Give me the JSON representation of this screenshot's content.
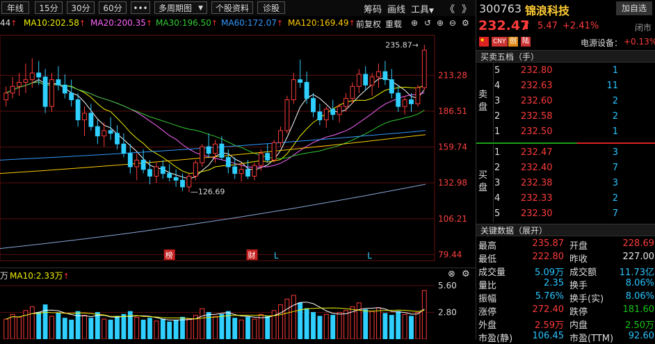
{
  "toolbar": {
    "periods": [
      "年线",
      "15分",
      "30分",
      "60分"
    ],
    "more": "•••",
    "multi_period": "多周期图",
    "stock_info": "个股资料",
    "diagnose": "诊股",
    "chips": "筹码",
    "draw": "画线",
    "tools": "工具",
    "collapse": "《",
    "expand": "》"
  },
  "ma_row": {
    "lead": "44",
    "ma10": "MA10:202.58",
    "ma20": "MA20:200.35",
    "ma30": "MA30:196.50",
    "ma60": "MA60:172.07",
    "ma120": "MA120:169.49",
    "adjust": "前复权",
    "overlay": "重载",
    "colors": {
      "ma10": "#f0f000",
      "ma20": "#ff66ff",
      "ma30": "#33cc33",
      "ma60": "#3399ff",
      "ma120": "#ffcc00"
    }
  },
  "chart_data": {
    "type": "candlestick",
    "y_axis_labels": [
      "213.28",
      "186.51",
      "159.74",
      "132.98",
      "106.21",
      "79.44"
    ],
    "y_axis_values": [
      213.28,
      186.51,
      159.74,
      132.98,
      106.21,
      79.44
    ],
    "high_annotation": "235.87",
    "low_annotation": "126.69",
    "event_markers": [
      {
        "label": "榜",
        "x": 0.39
      },
      {
        "label": "财",
        "x": 0.58
      },
      {
        "label": "L",
        "x": 0.635
      },
      {
        "label": "L",
        "x": 0.85
      }
    ],
    "candles": [
      [
        195,
        205,
        190,
        200
      ],
      [
        200,
        212,
        196,
        205
      ],
      [
        205,
        215,
        198,
        208
      ],
      [
        208,
        222,
        200,
        210
      ],
      [
        210,
        226,
        204,
        215
      ],
      [
        215,
        224,
        206,
        212
      ],
      [
        212,
        218,
        185,
        190
      ],
      [
        190,
        215,
        186,
        210
      ],
      [
        210,
        220,
        202,
        206
      ],
      [
        206,
        214,
        196,
        200
      ],
      [
        200,
        210,
        190,
        195
      ],
      [
        195,
        200,
        175,
        180
      ],
      [
        180,
        190,
        168,
        185
      ],
      [
        185,
        192,
        172,
        175
      ],
      [
        175,
        180,
        162,
        168
      ],
      [
        168,
        178,
        160,
        172
      ],
      [
        172,
        182,
        165,
        170
      ],
      [
        170,
        176,
        158,
        162
      ],
      [
        162,
        170,
        152,
        155
      ],
      [
        155,
        162,
        140,
        145
      ],
      [
        145,
        155,
        135,
        150
      ],
      [
        150,
        158,
        140,
        143
      ],
      [
        143,
        150,
        132,
        138
      ],
      [
        138,
        148,
        133,
        145
      ],
      [
        145,
        150,
        136,
        140
      ],
      [
        140,
        147,
        134,
        137
      ],
      [
        137,
        143,
        130,
        135
      ],
      [
        135,
        140,
        127,
        130
      ],
      [
        130,
        140,
        126,
        138
      ],
      [
        138,
        150,
        135,
        148
      ],
      [
        148,
        162,
        145,
        160
      ],
      [
        160,
        170,
        152,
        155
      ],
      [
        155,
        165,
        148,
        162
      ],
      [
        162,
        168,
        150,
        152
      ],
      [
        152,
        158,
        140,
        145
      ],
      [
        145,
        152,
        136,
        140
      ],
      [
        140,
        148,
        134,
        143
      ],
      [
        143,
        150,
        136,
        138
      ],
      [
        138,
        148,
        135,
        146
      ],
      [
        146,
        158,
        142,
        155
      ],
      [
        155,
        162,
        148,
        150
      ],
      [
        150,
        165,
        148,
        163
      ],
      [
        163,
        175,
        160,
        172
      ],
      [
        172,
        198,
        170,
        195
      ],
      [
        195,
        215,
        192,
        210
      ],
      [
        210,
        225,
        204,
        208
      ],
      [
        208,
        216,
        192,
        196
      ],
      [
        196,
        200,
        182,
        186
      ],
      [
        186,
        192,
        176,
        180
      ],
      [
        180,
        190,
        174,
        188
      ],
      [
        188,
        195,
        180,
        184
      ],
      [
        184,
        192,
        178,
        190
      ],
      [
        190,
        200,
        186,
        196
      ],
      [
        196,
        208,
        192,
        205
      ],
      [
        205,
        218,
        200,
        214
      ],
      [
        214,
        220,
        202,
        206
      ],
      [
        206,
        215,
        198,
        212
      ],
      [
        212,
        222,
        204,
        216
      ],
      [
        216,
        224,
        206,
        210
      ],
      [
        210,
        218,
        196,
        200
      ],
      [
        200,
        206,
        186,
        190
      ],
      [
        190,
        198,
        184,
        195
      ],
      [
        195,
        200,
        186,
        192
      ],
      [
        192,
        206,
        190,
        204
      ],
      [
        204,
        236,
        202,
        232
      ]
    ]
  },
  "volume": {
    "ma_label": "MA10:2.33万",
    "lead": "万",
    "y_axis_labels": [
      "5.60",
      "2.80"
    ],
    "values": [
      2.1,
      2.6,
      2.3,
      3.0,
      3.4,
      2.8,
      3.6,
      2.4,
      2.7,
      2.2,
      2.0,
      2.9,
      2.5,
      2.2,
      2.8,
      2.1,
      2.0,
      2.4,
      2.6,
      2.9,
      2.3,
      2.0,
      2.2,
      1.9,
      2.1,
      1.8,
      2.0,
      2.3,
      2.1,
      2.5,
      3.2,
      2.8,
      2.4,
      2.6,
      2.9,
      2.2,
      2.0,
      2.3,
      2.1,
      2.6,
      2.4,
      3.0,
      3.6,
      4.2,
      4.6,
      3.8,
      3.2,
      2.8,
      2.4,
      2.6,
      2.5,
      2.8,
      3.0,
      3.4,
      3.8,
      3.1,
      2.9,
      3.3,
      2.7,
      2.5,
      2.9,
      2.6,
      2.4,
      2.8,
      5.1
    ]
  },
  "quote": {
    "code": "300763",
    "name": "锦浪科技",
    "add_watch": "加自选",
    "price": "232.47",
    "change": "5.47",
    "pct": "+2.41%",
    "status": "闭市",
    "tags": [
      "CNY",
      "创",
      "陆"
    ],
    "sector": "电源设备：",
    "sector_pct": "+0.13%"
  },
  "orderbook": {
    "title": "买卖五档（手）",
    "sell_label": "卖盘",
    "buy_label": "买盘",
    "sell": [
      {
        "lvl": "5",
        "price": "232.80",
        "vol": "1"
      },
      {
        "lvl": "4",
        "price": "232.63",
        "vol": "11"
      },
      {
        "lvl": "3",
        "price": "232.60",
        "vol": "2"
      },
      {
        "lvl": "2",
        "price": "232.58",
        "vol": "2"
      },
      {
        "lvl": "1",
        "price": "232.50",
        "vol": "1"
      }
    ],
    "buy": [
      {
        "lvl": "1",
        "price": "232.47",
        "vol": "3"
      },
      {
        "lvl": "2",
        "price": "232.40",
        "vol": "7"
      },
      {
        "lvl": "3",
        "price": "232.38",
        "vol": "3"
      },
      {
        "lvl": "4",
        "price": "232.33",
        "vol": "2"
      },
      {
        "lvl": "5",
        "price": "232.30",
        "vol": "7"
      }
    ]
  },
  "keydata": {
    "title": "关键数据（展开）",
    "rows": [
      {
        "l1": "最高",
        "v1": "235.87",
        "c1": "red",
        "l2": "开盘",
        "v2": "228.69",
        "c2": "red"
      },
      {
        "l1": "最低",
        "v1": "222.80",
        "c1": "red",
        "l2": "昨收",
        "v2": "227.00",
        "c2": "white"
      },
      {
        "l1": "成交量",
        "v1": "5.09万",
        "c1": "cyan",
        "l2": "成交额",
        "v2": "11.73亿",
        "c2": "cyan"
      },
      {
        "l1": "量比",
        "v1": "2.35",
        "c1": "cyan",
        "l2": "换手",
        "v2": "8.06%",
        "c2": "cyan"
      },
      {
        "l1": "振幅",
        "v1": "5.76%",
        "c1": "cyan",
        "l2": "换手(实)",
        "v2": "8.06%",
        "c2": "cyan"
      },
      {
        "l1": "涨停",
        "v1": "272.40",
        "c1": "red",
        "l2": "跌停",
        "v2": "181.60",
        "c2": "green"
      },
      {
        "l1": "外盘",
        "v1": "2.59万",
        "c1": "red",
        "l2": "内盘",
        "v2": "2.50万",
        "c2": "green"
      },
      {
        "l1": "市盈(静)",
        "v1": "106.45",
        "c1": "cyan",
        "l2": "市盈(TTM)",
        "v2": "92.60",
        "c2": "cyan"
      }
    ]
  }
}
